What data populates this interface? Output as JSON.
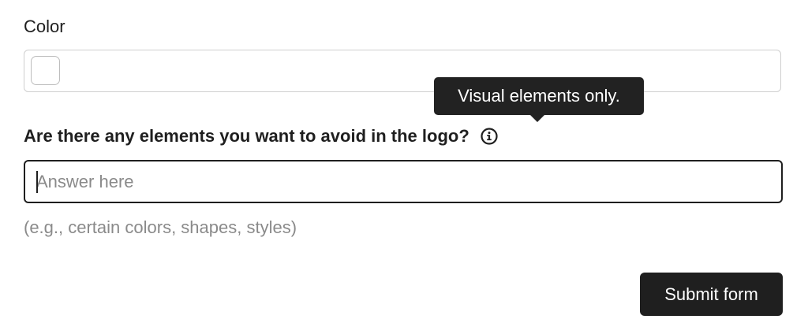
{
  "color_field": {
    "label": "Color",
    "swatch_color": "#ffffff"
  },
  "avoid_field": {
    "label": "Are there any elements you want to avoid in the logo?",
    "info_icon": "info-icon",
    "tooltip": "Visual elements only.",
    "placeholder": "Answer here",
    "value": "",
    "hint": "(e.g., certain colors, shapes, styles)"
  },
  "submit": {
    "label": "Submit form"
  },
  "colors": {
    "text": "#1f1f1f",
    "muted": "#8a8a8a",
    "button_bg": "#1f1f1f",
    "tooltip_bg": "#222222",
    "border": "#cfcfcf"
  }
}
